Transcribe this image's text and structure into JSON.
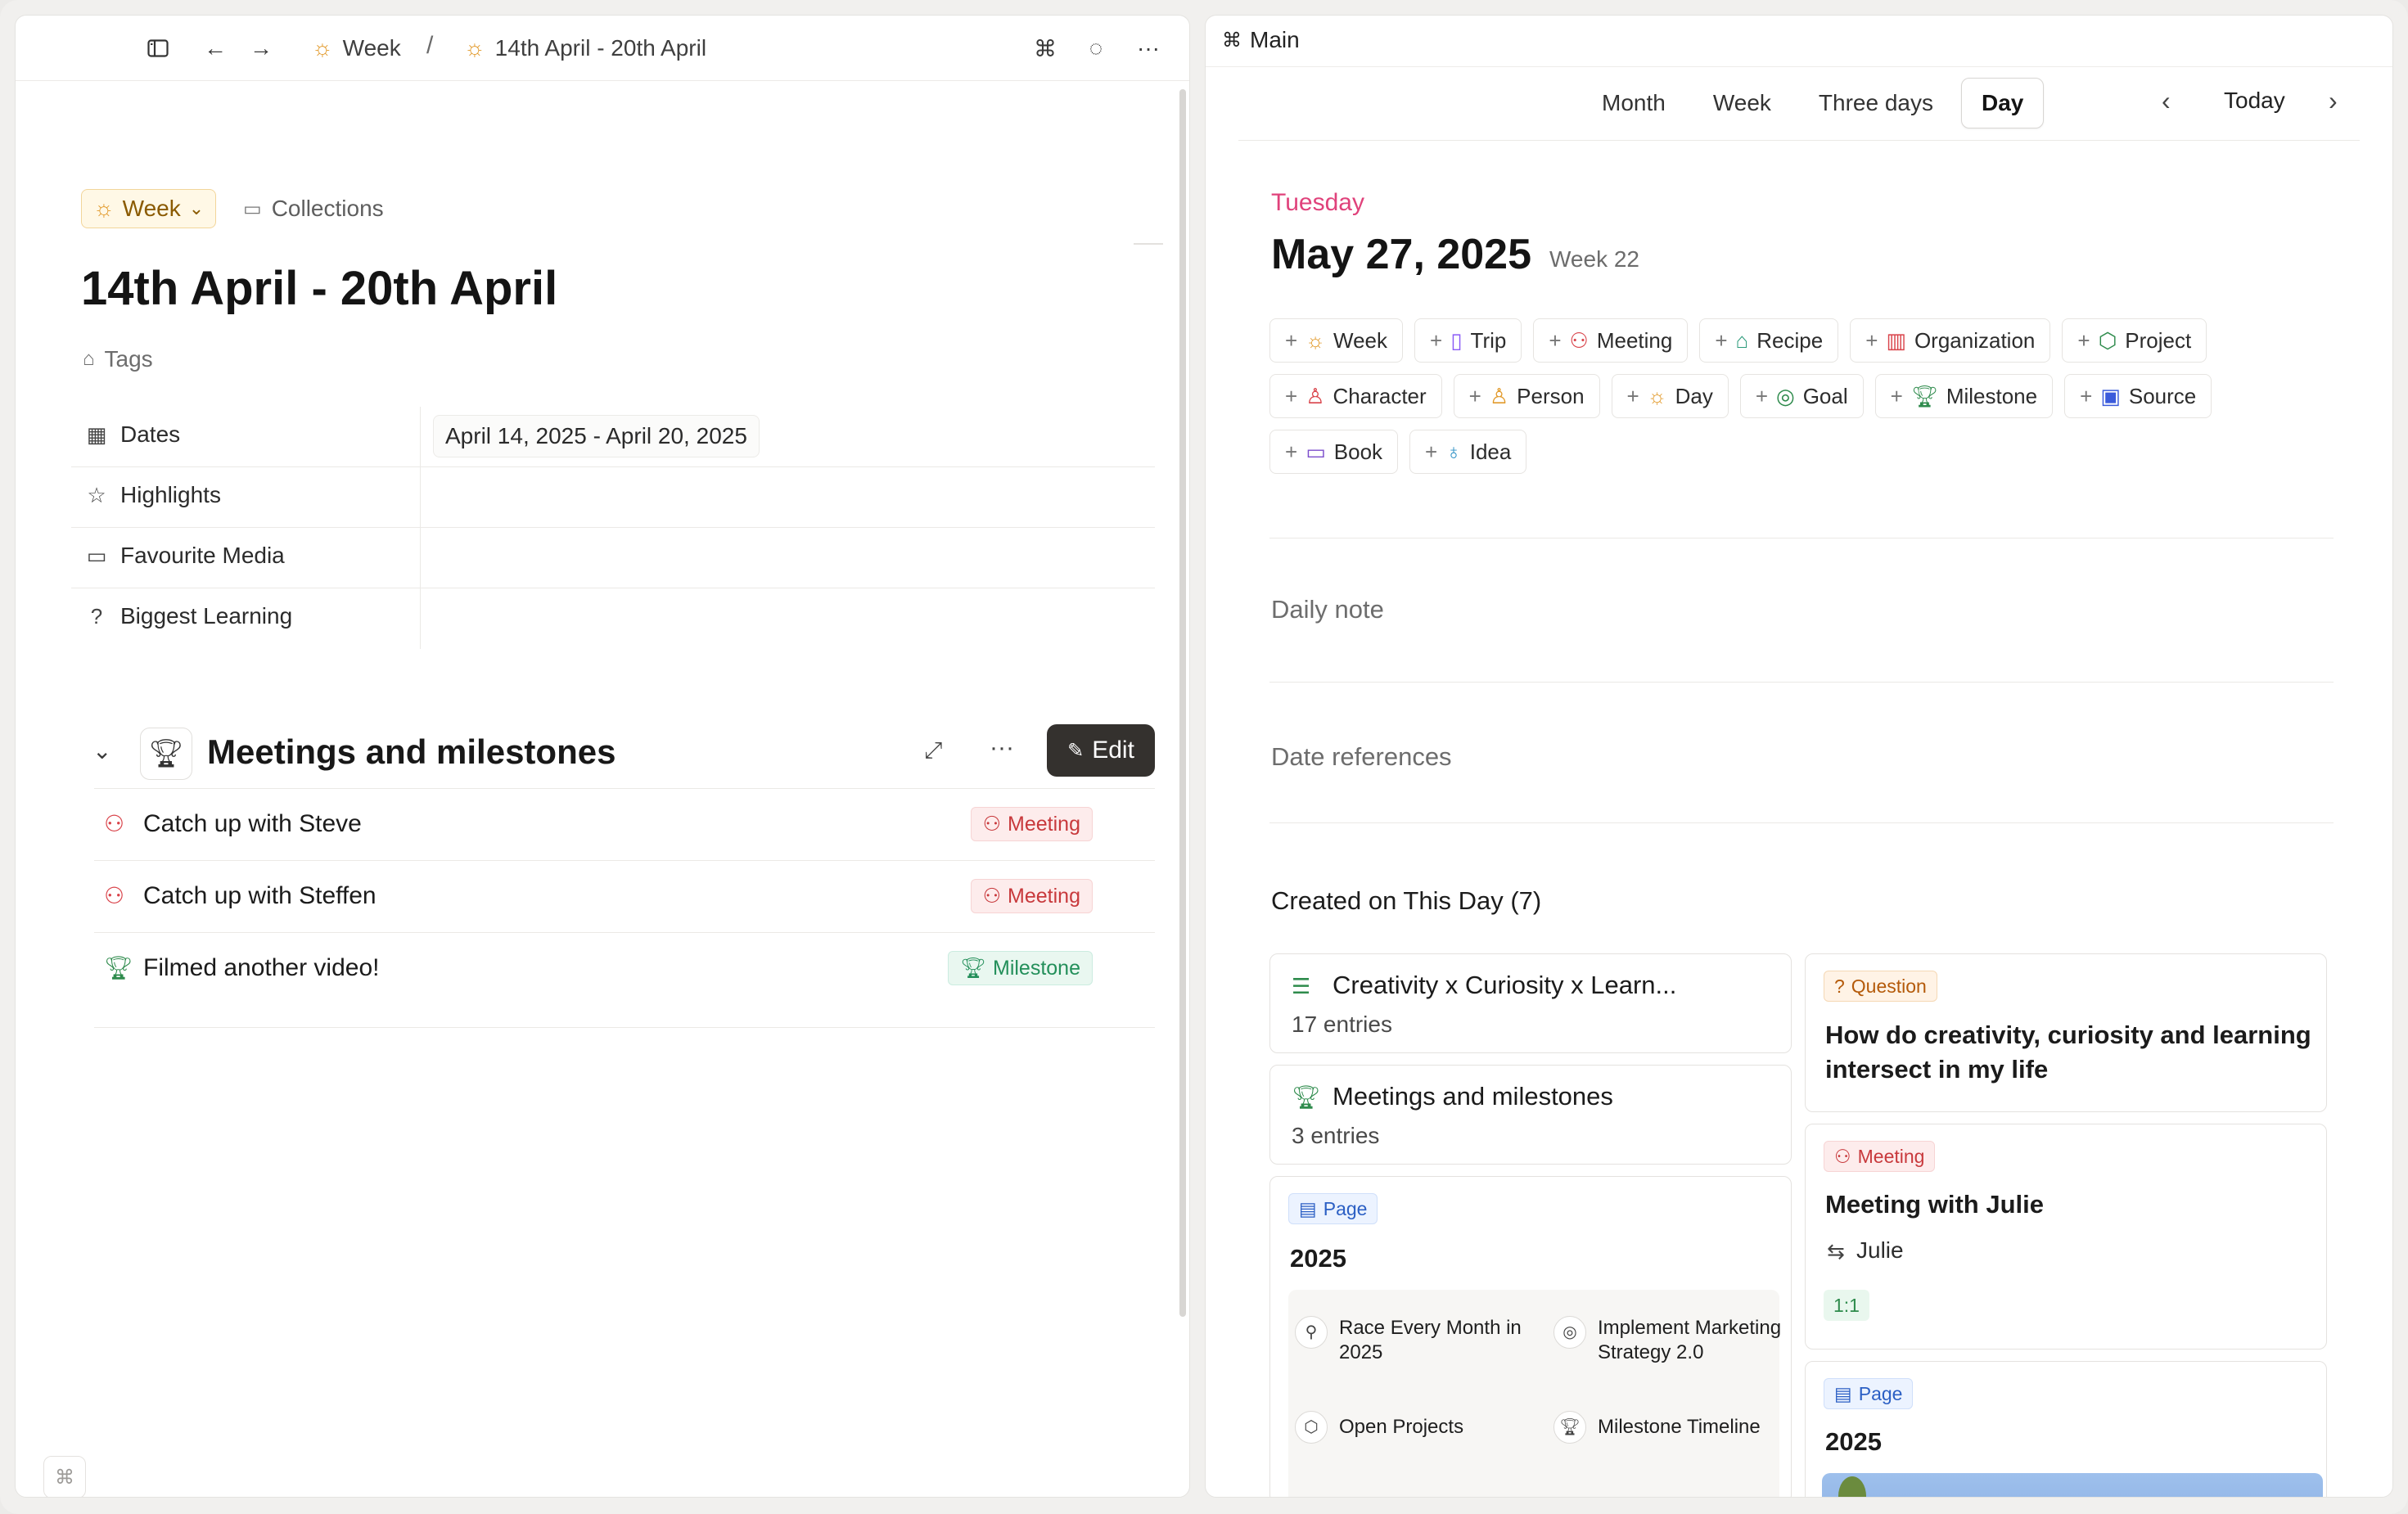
{
  "left": {
    "breadcrumb": {
      "first": "Week",
      "separator": "/",
      "second": "14th April - 20th April"
    },
    "type_chip": "Week",
    "collections": "Collections",
    "title": "14th April - 20th April",
    "tags": "Tags",
    "properties": [
      {
        "label": "Dates",
        "value": "April 14, 2025 - April 20, 2025",
        "icon": "calendar-icon"
      },
      {
        "label": "Highlights",
        "value": "",
        "icon": "star-icon"
      },
      {
        "label": "Favourite Media",
        "value": "",
        "icon": "monitor-icon"
      },
      {
        "label": "Biggest Learning",
        "value": "",
        "icon": "question-circle-icon"
      }
    ],
    "section": {
      "title": "Meetings and milestones",
      "edit_label": "Edit",
      "entries": [
        {
          "title": "Catch up with Steve",
          "badge": "Meeting",
          "kind": "meeting"
        },
        {
          "title": "Catch up with Steffen",
          "badge": "Meeting",
          "kind": "meeting"
        },
        {
          "title": "Filmed another video!",
          "badge": "Milestone",
          "kind": "milestone"
        }
      ]
    },
    "cmd_hint": "⌘"
  },
  "right": {
    "workspace": "Main",
    "views": [
      "Month",
      "Week",
      "Three days",
      "Day"
    ],
    "active_view": "Day",
    "today": "Today",
    "weekday": "Tuesday",
    "date": "May 27, 2025",
    "week": "Week 22",
    "quick_add": [
      {
        "label": "Week",
        "icon": "sun-icon",
        "color": "#e29a2b"
      },
      {
        "label": "Trip",
        "icon": "luggage-icon",
        "color": "#8b5cf6"
      },
      {
        "label": "Meeting",
        "icon": "people-icon",
        "color": "#d9434a"
      },
      {
        "label": "Recipe",
        "icon": "chef-hat-icon",
        "color": "#2b9a7a"
      },
      {
        "label": "Organization",
        "icon": "building-icon",
        "color": "#d9434a"
      },
      {
        "label": "Project",
        "icon": "cube-icon",
        "color": "#2e8b4c"
      },
      {
        "label": "Character",
        "icon": "character-icon",
        "color": "#d9434a"
      },
      {
        "label": "Person",
        "icon": "person-icon",
        "color": "#e29a2b"
      },
      {
        "label": "Day",
        "icon": "sun-icon",
        "color": "#e29a2b"
      },
      {
        "label": "Goal",
        "icon": "target-icon",
        "color": "#2e8b4c"
      },
      {
        "label": "Milestone",
        "icon": "trophy-icon",
        "color": "#2e8b4c"
      },
      {
        "label": "Source",
        "icon": "source-icon",
        "color": "#3b5bdb"
      },
      {
        "label": "Book",
        "icon": "book-icon",
        "color": "#7c4dcc"
      },
      {
        "label": "Idea",
        "icon": "bulb-icon",
        "color": "#2b8fc4"
      }
    ],
    "daily_note": "Daily note",
    "date_references": "Date references",
    "created_title": "Created on This Day (7)",
    "cards": {
      "creativity": {
        "title": "Creativity x Curiosity x Learn...",
        "sub": "17 entries"
      },
      "meetings": {
        "title": "Meetings and milestones",
        "sub": "3 entries"
      },
      "page_2025": {
        "badge": "Page",
        "title": "2025",
        "items": [
          "Race Every Month in 2025",
          "Implement Marketing Strategy 2.0",
          "Open Projects",
          "Milestone Timeline"
        ]
      },
      "question": {
        "badge": "Question",
        "title": "How do creativity, curiosity and learning intersect in my life"
      },
      "meeting_julie": {
        "badge": "Meeting",
        "title": "Meeting with Julie",
        "person": "Julie",
        "tag": "1:1"
      },
      "page_2025_b": {
        "badge": "Page",
        "title": "2025"
      }
    }
  }
}
